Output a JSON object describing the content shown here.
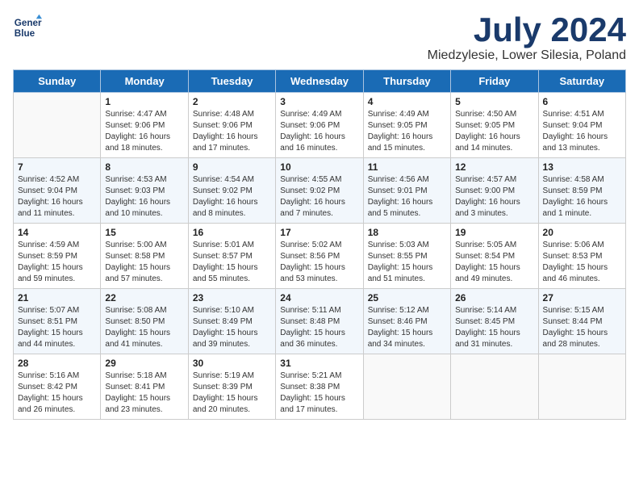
{
  "header": {
    "logo_line1": "General",
    "logo_line2": "Blue",
    "month_year": "July 2024",
    "location": "Miedzylesie, Lower Silesia, Poland"
  },
  "columns": [
    "Sunday",
    "Monday",
    "Tuesday",
    "Wednesday",
    "Thursday",
    "Friday",
    "Saturday"
  ],
  "weeks": [
    [
      {
        "day": "",
        "empty": true
      },
      {
        "day": "1",
        "sunrise": "Sunrise: 4:47 AM",
        "sunset": "Sunset: 9:06 PM",
        "daylight": "Daylight: 16 hours and 18 minutes."
      },
      {
        "day": "2",
        "sunrise": "Sunrise: 4:48 AM",
        "sunset": "Sunset: 9:06 PM",
        "daylight": "Daylight: 16 hours and 17 minutes."
      },
      {
        "day": "3",
        "sunrise": "Sunrise: 4:49 AM",
        "sunset": "Sunset: 9:06 PM",
        "daylight": "Daylight: 16 hours and 16 minutes."
      },
      {
        "day": "4",
        "sunrise": "Sunrise: 4:49 AM",
        "sunset": "Sunset: 9:05 PM",
        "daylight": "Daylight: 16 hours and 15 minutes."
      },
      {
        "day": "5",
        "sunrise": "Sunrise: 4:50 AM",
        "sunset": "Sunset: 9:05 PM",
        "daylight": "Daylight: 16 hours and 14 minutes."
      },
      {
        "day": "6",
        "sunrise": "Sunrise: 4:51 AM",
        "sunset": "Sunset: 9:04 PM",
        "daylight": "Daylight: 16 hours and 13 minutes."
      }
    ],
    [
      {
        "day": "7",
        "sunrise": "Sunrise: 4:52 AM",
        "sunset": "Sunset: 9:04 PM",
        "daylight": "Daylight: 16 hours and 11 minutes."
      },
      {
        "day": "8",
        "sunrise": "Sunrise: 4:53 AM",
        "sunset": "Sunset: 9:03 PM",
        "daylight": "Daylight: 16 hours and 10 minutes."
      },
      {
        "day": "9",
        "sunrise": "Sunrise: 4:54 AM",
        "sunset": "Sunset: 9:02 PM",
        "daylight": "Daylight: 16 hours and 8 minutes."
      },
      {
        "day": "10",
        "sunrise": "Sunrise: 4:55 AM",
        "sunset": "Sunset: 9:02 PM",
        "daylight": "Daylight: 16 hours and 7 minutes."
      },
      {
        "day": "11",
        "sunrise": "Sunrise: 4:56 AM",
        "sunset": "Sunset: 9:01 PM",
        "daylight": "Daylight: 16 hours and 5 minutes."
      },
      {
        "day": "12",
        "sunrise": "Sunrise: 4:57 AM",
        "sunset": "Sunset: 9:00 PM",
        "daylight": "Daylight: 16 hours and 3 minutes."
      },
      {
        "day": "13",
        "sunrise": "Sunrise: 4:58 AM",
        "sunset": "Sunset: 8:59 PM",
        "daylight": "Daylight: 16 hours and 1 minute."
      }
    ],
    [
      {
        "day": "14",
        "sunrise": "Sunrise: 4:59 AM",
        "sunset": "Sunset: 8:59 PM",
        "daylight": "Daylight: 15 hours and 59 minutes."
      },
      {
        "day": "15",
        "sunrise": "Sunrise: 5:00 AM",
        "sunset": "Sunset: 8:58 PM",
        "daylight": "Daylight: 15 hours and 57 minutes."
      },
      {
        "day": "16",
        "sunrise": "Sunrise: 5:01 AM",
        "sunset": "Sunset: 8:57 PM",
        "daylight": "Daylight: 15 hours and 55 minutes."
      },
      {
        "day": "17",
        "sunrise": "Sunrise: 5:02 AM",
        "sunset": "Sunset: 8:56 PM",
        "daylight": "Daylight: 15 hours and 53 minutes."
      },
      {
        "day": "18",
        "sunrise": "Sunrise: 5:03 AM",
        "sunset": "Sunset: 8:55 PM",
        "daylight": "Daylight: 15 hours and 51 minutes."
      },
      {
        "day": "19",
        "sunrise": "Sunrise: 5:05 AM",
        "sunset": "Sunset: 8:54 PM",
        "daylight": "Daylight: 15 hours and 49 minutes."
      },
      {
        "day": "20",
        "sunrise": "Sunrise: 5:06 AM",
        "sunset": "Sunset: 8:53 PM",
        "daylight": "Daylight: 15 hours and 46 minutes."
      }
    ],
    [
      {
        "day": "21",
        "sunrise": "Sunrise: 5:07 AM",
        "sunset": "Sunset: 8:51 PM",
        "daylight": "Daylight: 15 hours and 44 minutes."
      },
      {
        "day": "22",
        "sunrise": "Sunrise: 5:08 AM",
        "sunset": "Sunset: 8:50 PM",
        "daylight": "Daylight: 15 hours and 41 minutes."
      },
      {
        "day": "23",
        "sunrise": "Sunrise: 5:10 AM",
        "sunset": "Sunset: 8:49 PM",
        "daylight": "Daylight: 15 hours and 39 minutes."
      },
      {
        "day": "24",
        "sunrise": "Sunrise: 5:11 AM",
        "sunset": "Sunset: 8:48 PM",
        "daylight": "Daylight: 15 hours and 36 minutes."
      },
      {
        "day": "25",
        "sunrise": "Sunrise: 5:12 AM",
        "sunset": "Sunset: 8:46 PM",
        "daylight": "Daylight: 15 hours and 34 minutes."
      },
      {
        "day": "26",
        "sunrise": "Sunrise: 5:14 AM",
        "sunset": "Sunset: 8:45 PM",
        "daylight": "Daylight: 15 hours and 31 minutes."
      },
      {
        "day": "27",
        "sunrise": "Sunrise: 5:15 AM",
        "sunset": "Sunset: 8:44 PM",
        "daylight": "Daylight: 15 hours and 28 minutes."
      }
    ],
    [
      {
        "day": "28",
        "sunrise": "Sunrise: 5:16 AM",
        "sunset": "Sunset: 8:42 PM",
        "daylight": "Daylight: 15 hours and 26 minutes."
      },
      {
        "day": "29",
        "sunrise": "Sunrise: 5:18 AM",
        "sunset": "Sunset: 8:41 PM",
        "daylight": "Daylight: 15 hours and 23 minutes."
      },
      {
        "day": "30",
        "sunrise": "Sunrise: 5:19 AM",
        "sunset": "Sunset: 8:39 PM",
        "daylight": "Daylight: 15 hours and 20 minutes."
      },
      {
        "day": "31",
        "sunrise": "Sunrise: 5:21 AM",
        "sunset": "Sunset: 8:38 PM",
        "daylight": "Daylight: 15 hours and 17 minutes."
      },
      {
        "day": "",
        "empty": true
      },
      {
        "day": "",
        "empty": true
      },
      {
        "day": "",
        "empty": true
      }
    ]
  ]
}
